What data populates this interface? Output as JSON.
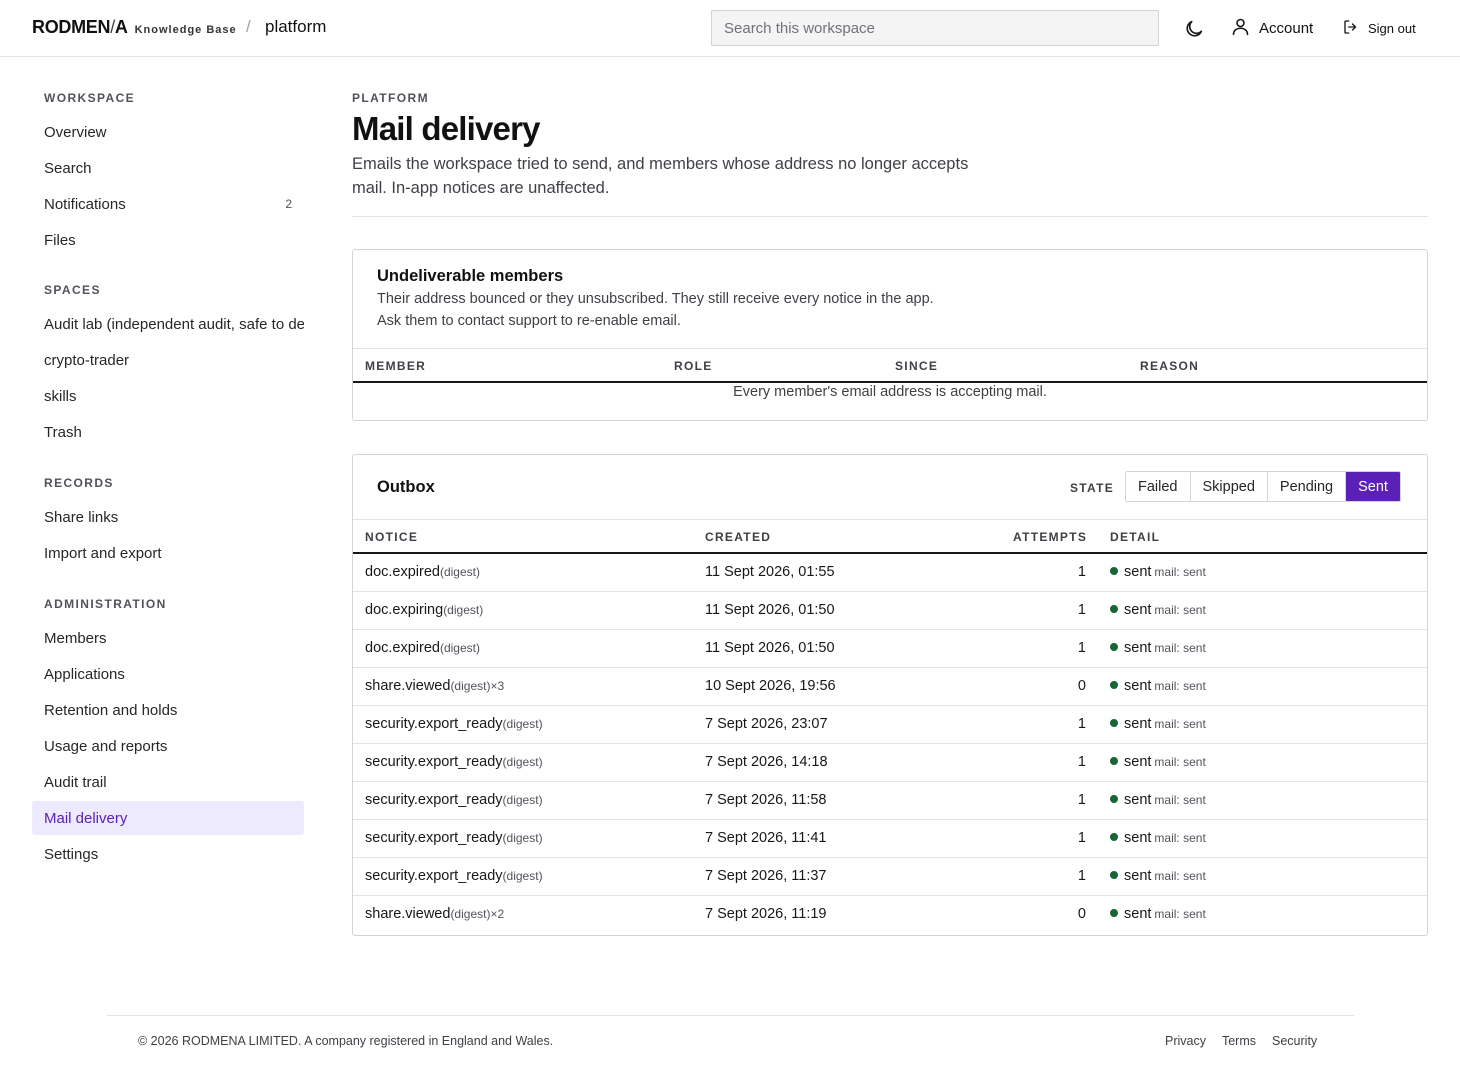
{
  "header": {
    "brand_main": "RODMEN",
    "brand_slash": "/",
    "brand_tail": "A",
    "brand_sub": "Knowledge Base",
    "crumb_sep": "/",
    "workspace": "platform",
    "search_placeholder": "Search this workspace",
    "account_label": "Account",
    "signout_label": "Sign out"
  },
  "sidebar": {
    "sections": [
      {
        "title": "WORKSPACE",
        "items": [
          {
            "label": "Overview"
          },
          {
            "label": "Search"
          },
          {
            "label": "Notifications",
            "count": "2"
          },
          {
            "label": "Files"
          }
        ]
      },
      {
        "title": "SPACES",
        "items": [
          {
            "label": "Audit lab (independent audit, safe to de"
          },
          {
            "label": "crypto-trader"
          },
          {
            "label": "skills"
          },
          {
            "label": "Trash"
          }
        ]
      },
      {
        "title": "RECORDS",
        "items": [
          {
            "label": "Share links"
          },
          {
            "label": "Import and export"
          }
        ]
      },
      {
        "title": "ADMINISTRATION",
        "items": [
          {
            "label": "Members"
          },
          {
            "label": "Applications"
          },
          {
            "label": "Retention and holds"
          },
          {
            "label": "Usage and reports"
          },
          {
            "label": "Audit trail"
          },
          {
            "label": "Mail delivery",
            "active": true
          },
          {
            "label": "Settings"
          }
        ]
      }
    ]
  },
  "page": {
    "eyebrow": "PLATFORM",
    "title": "Mail delivery",
    "description": "Emails the workspace tried to send, and members whose address no longer accepts mail. In-app notices are unaffected."
  },
  "undeliverable": {
    "title": "Undeliverable members",
    "description": "Their address bounced or they unsubscribed. They still receive every notice in the app. Ask them to contact support to re-enable email.",
    "columns": [
      "MEMBER",
      "ROLE",
      "SINCE",
      "REASON"
    ],
    "empty": "Every member's email address is accepting mail."
  },
  "outbox": {
    "title": "Outbox",
    "state_label": "STATE",
    "states": [
      {
        "label": "Failed",
        "active": false
      },
      {
        "label": "Skipped",
        "active": false
      },
      {
        "label": "Pending",
        "active": false
      },
      {
        "label": "Sent",
        "active": true
      }
    ],
    "columns": [
      "NOTICE",
      "CREATED",
      "ATTEMPTS",
      "DETAIL"
    ],
    "status_color": "#166534",
    "rows": [
      {
        "notice": "doc.expired",
        "tag": "(digest)",
        "created": "11 Sept 2026, 01:55",
        "attempts": "1",
        "status": "sent",
        "detail": "mail: sent"
      },
      {
        "notice": "doc.expiring",
        "tag": "(digest)",
        "created": "11 Sept 2026, 01:50",
        "attempts": "1",
        "status": "sent",
        "detail": "mail: sent"
      },
      {
        "notice": "doc.expired",
        "tag": "(digest)",
        "created": "11 Sept 2026, 01:50",
        "attempts": "1",
        "status": "sent",
        "detail": "mail: sent"
      },
      {
        "notice": "share.viewed",
        "tag": "(digest)×3",
        "created": "10 Sept 2026, 19:56",
        "attempts": "0",
        "status": "sent",
        "detail": "mail: sent"
      },
      {
        "notice": "security.export_ready",
        "tag": "(digest)",
        "created": "7 Sept 2026, 23:07",
        "attempts": "1",
        "status": "sent",
        "detail": "mail: sent"
      },
      {
        "notice": "security.export_ready",
        "tag": "(digest)",
        "created": "7 Sept 2026, 14:18",
        "attempts": "1",
        "status": "sent",
        "detail": "mail: sent"
      },
      {
        "notice": "security.export_ready",
        "tag": "(digest)",
        "created": "7 Sept 2026, 11:58",
        "attempts": "1",
        "status": "sent",
        "detail": "mail: sent"
      },
      {
        "notice": "security.export_ready",
        "tag": "(digest)",
        "created": "7 Sept 2026, 11:41",
        "attempts": "1",
        "status": "sent",
        "detail": "mail: sent"
      },
      {
        "notice": "security.export_ready",
        "tag": "(digest)",
        "created": "7 Sept 2026, 11:37",
        "attempts": "1",
        "status": "sent",
        "detail": "mail: sent"
      },
      {
        "notice": "share.viewed",
        "tag": "(digest)×2",
        "created": "7 Sept 2026, 11:19",
        "attempts": "0",
        "status": "sent",
        "detail": "mail: sent"
      }
    ]
  },
  "footer": {
    "copyright": "© 2026 RODMENA LIMITED. A company registered in England and Wales.",
    "links": [
      "Privacy",
      "Terms",
      "Security"
    ]
  },
  "colors": {
    "accent": "#5b21b6",
    "accent_soft": "#ede9fe"
  }
}
